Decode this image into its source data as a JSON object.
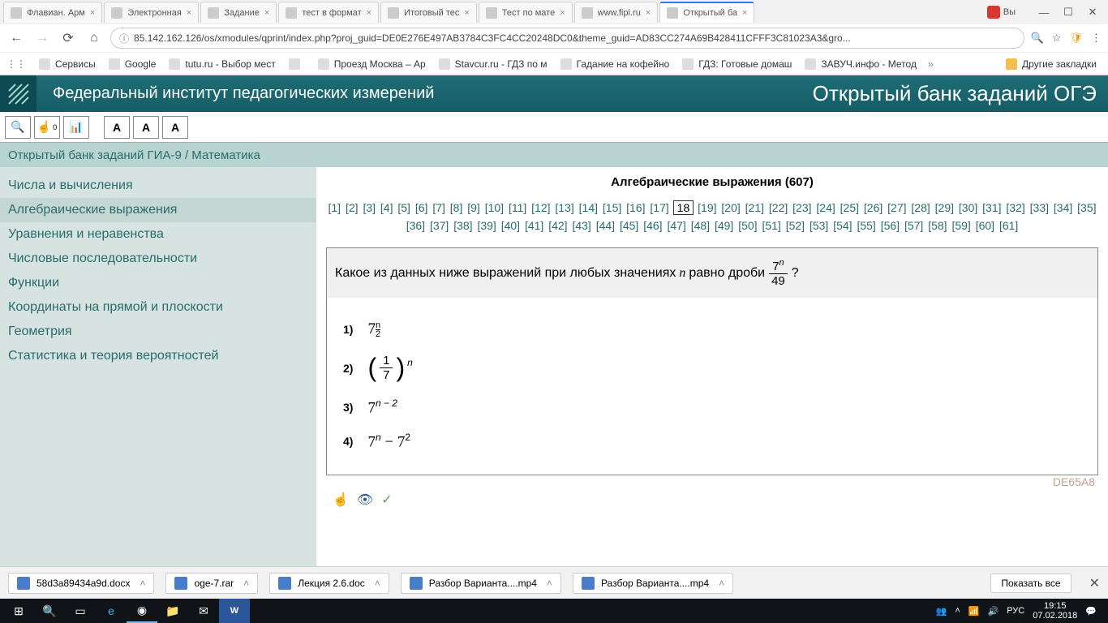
{
  "tabs": [
    {
      "title": "Флавиан. Арм",
      "active": false
    },
    {
      "title": "Электронная",
      "active": false
    },
    {
      "title": "Задание",
      "active": false
    },
    {
      "title": "тест в формат",
      "active": false
    },
    {
      "title": "Итоговый тес",
      "active": false
    },
    {
      "title": "Тест по мате",
      "active": false
    },
    {
      "title": "www.fipi.ru",
      "active": false
    },
    {
      "title": "Открытый ба",
      "active": true
    }
  ],
  "window_sign": "Вы",
  "url": "85.142.162.126/os/xmodules/qprint/index.php?proj_guid=DE0E276E497AB3784C3FC4CC20248DC0&theme_guid=AD83CC274A69B428411CFFF3C81023A3&gro...",
  "bookmarks": [
    {
      "label": "Сервисы"
    },
    {
      "label": "Google"
    },
    {
      "label": "tutu.ru - Выбор мест"
    },
    {
      "label": ""
    },
    {
      "label": "Проезд Москва – Ар"
    },
    {
      "label": "Stavcur.ru - ГДЗ по м"
    },
    {
      "label": "Гадание на кофейно"
    },
    {
      "label": "ГДЗ: Готовые домаш"
    },
    {
      "label": "ЗАВУЧ.инфо - Метод"
    }
  ],
  "other_bookmarks": "Другие закладки",
  "header": {
    "title": "Федеральный институт педагогических измерений",
    "right": "Открытый банк заданий ОГЭ"
  },
  "breadcrumb": "Открытый банк заданий ГИА-9 / Математика",
  "sidebar": [
    "Числа и вычисления",
    "Алгебраические выражения",
    "Уравнения и неравенства",
    "Числовые последовательности",
    "Функции",
    "Координаты на прямой и плоскости",
    "Геометрия",
    "Статистика и теория вероятностей"
  ],
  "sidebar_active": 1,
  "topic_title": "Алгебраические выражения (607)",
  "pager": {
    "total": 61,
    "current": 18
  },
  "question": {
    "prefix": "Какое из данных ниже выражений при любых значениях ",
    "var": "n",
    "mid": " равно дроби ",
    "frac_num": "7",
    "frac_num_sup": "n",
    "frac_den": "49",
    "suffix": "?"
  },
  "answers": [
    {
      "n": "1)",
      "html": "7<span class='subfrac'><span>n</span><span>2</span></span>"
    },
    {
      "n": "2)",
      "html": "<span class='big-paren'>(</span><span class='frac'><span class='num'>1</span><span class='den'>7</span></span><span class='big-paren'>)</span><span class='sup' style='margin-left:3px;font-style:italic'>n</span>"
    },
    {
      "n": "3)",
      "html": "7<span class='sup' style='font-style:italic'>n − 2</span>"
    },
    {
      "n": "4)",
      "html": "7<span class='sup' style='font-style:italic'>n</span> − 7<span class='sup'>2</span>"
    }
  ],
  "task_id": "DE65A8",
  "downloads": [
    {
      "name": "58d3a89434a9d.docx"
    },
    {
      "name": "oge-7.rar"
    },
    {
      "name": "Лекция 2.6.doc"
    },
    {
      "name": "Разбор Варианта....mp4"
    },
    {
      "name": "Разбор Варианта....mp4"
    }
  ],
  "show_all": "Показать все",
  "taskbar": {
    "lang": "РУС",
    "time": "19:15",
    "date": "07.02.2018"
  }
}
